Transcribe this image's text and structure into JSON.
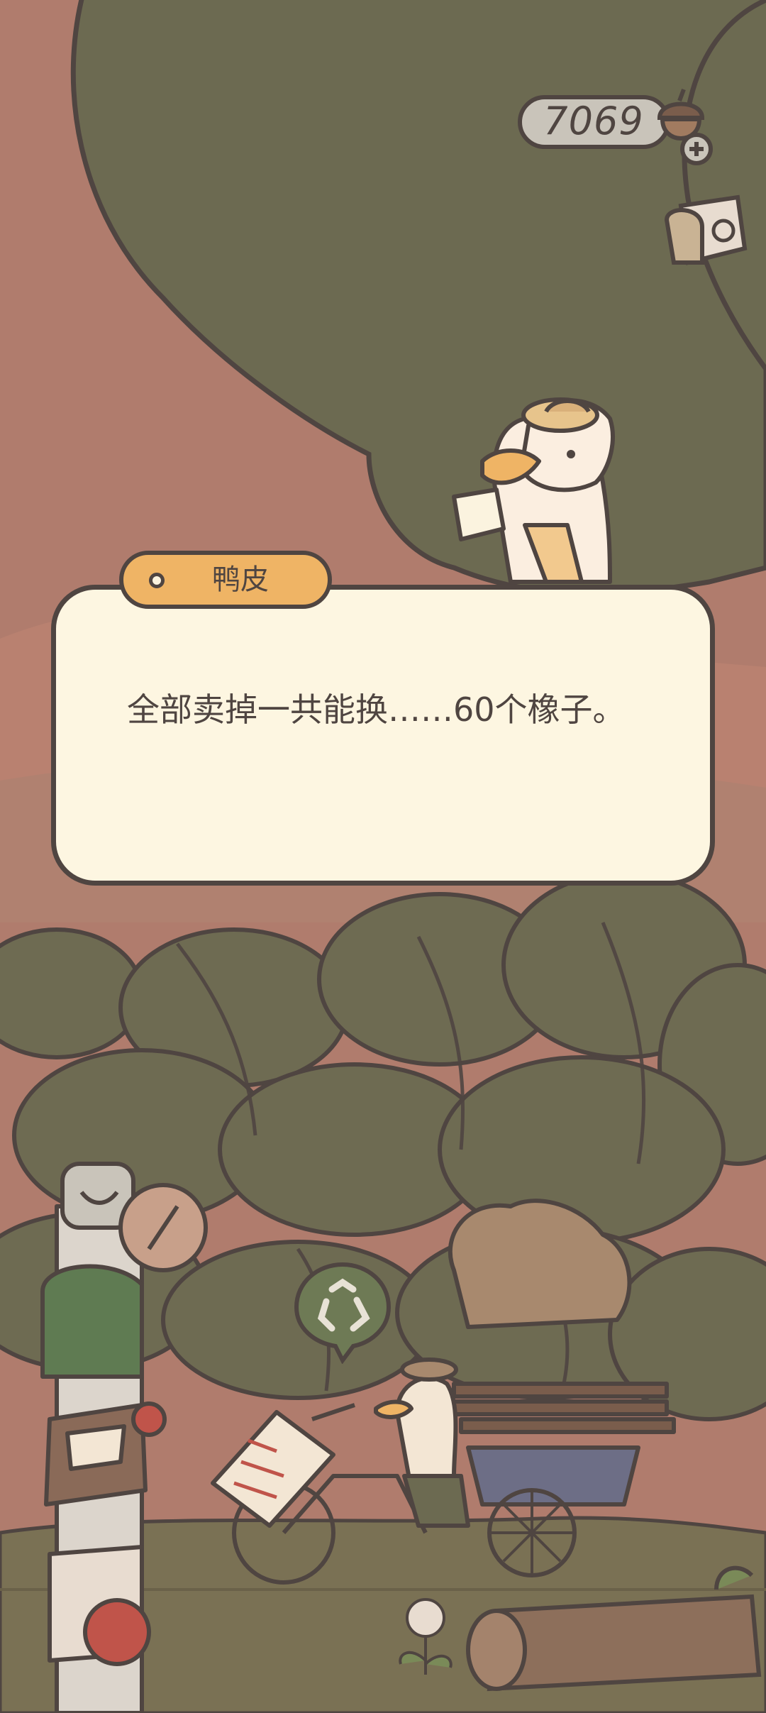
{
  "hud": {
    "acorn_count": "7069",
    "acorn_icon": "acorn-icon",
    "add_icon": "plus-icon",
    "side_tool_icon": "bag-tool-icon"
  },
  "dialog": {
    "speaker": "鸭皮",
    "text": "全部卖掉一共能换……60个橡子。"
  },
  "scene": {
    "npc": "duck-explorer",
    "recycle_icon": "recycle-icon",
    "shop_sign": "回收"
  },
  "colors": {
    "outline": "#4f4541",
    "background": "#b07c6d",
    "foliage": "#6c6a51",
    "dialog_bg": "#fdf6e1",
    "name_tag": "#efb465"
  }
}
